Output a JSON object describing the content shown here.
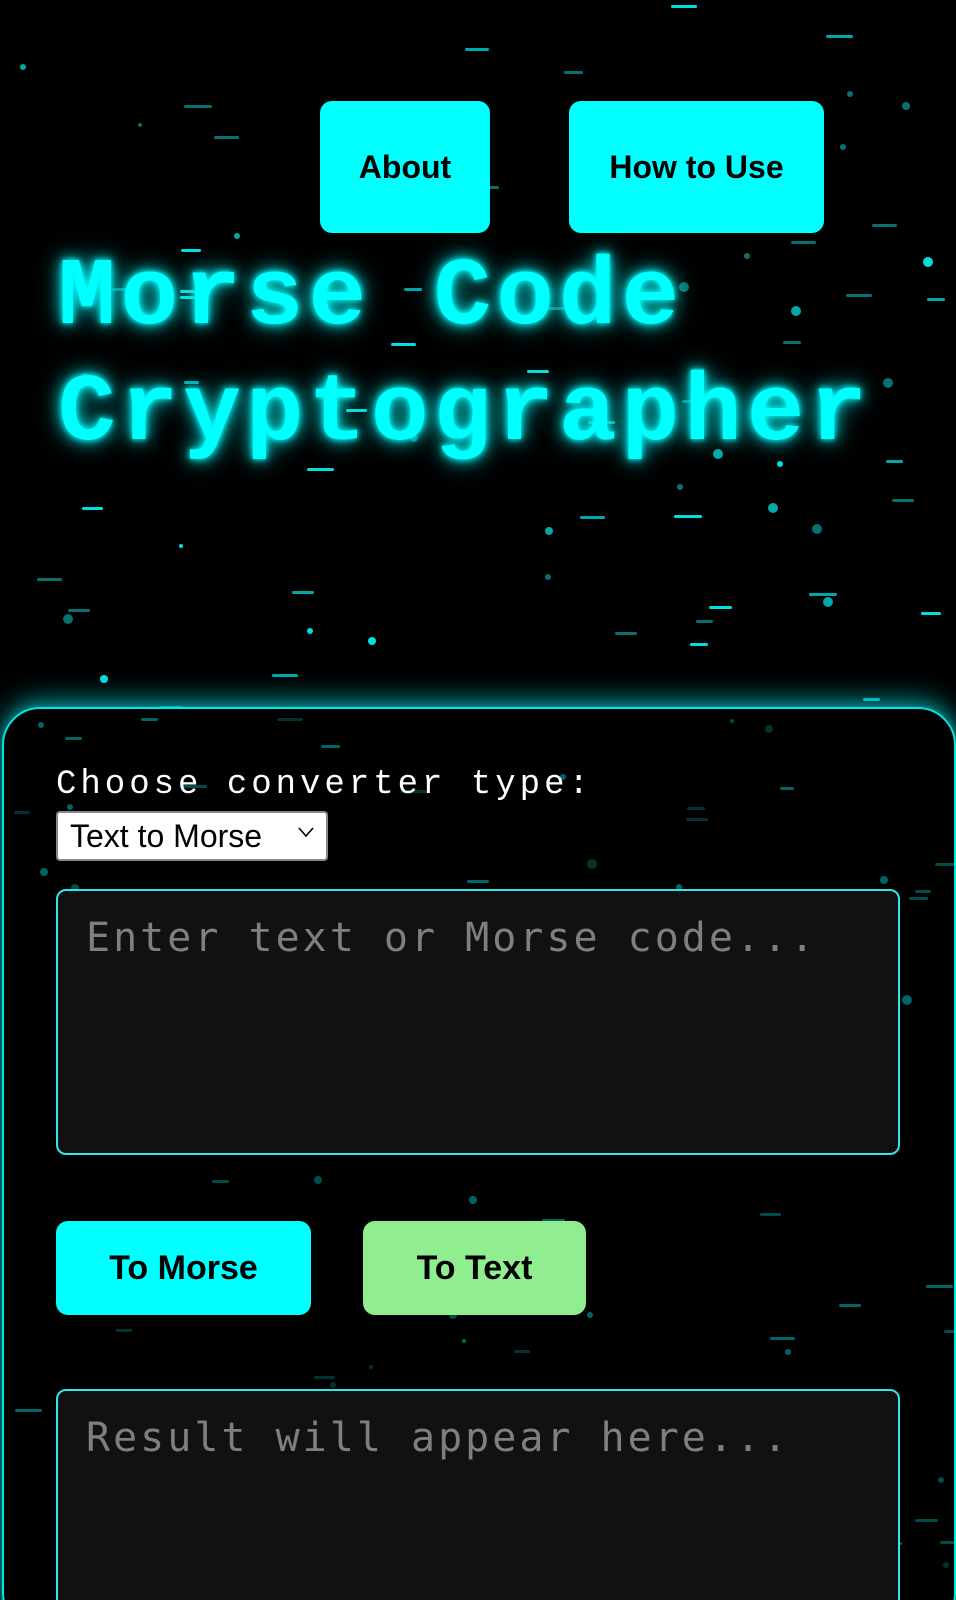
{
  "nav": {
    "about_label": "About",
    "howto_label": "How to Use"
  },
  "header": {
    "title_line1": "Morse Code",
    "title_line2": "Cryptographer"
  },
  "converter": {
    "label": "Choose converter type:",
    "selected_type": "Text to Morse",
    "input_placeholder": "Enter text or Morse code...",
    "to_morse_label": "To Morse",
    "to_text_label": "To Text",
    "result_placeholder": "Result will appear here..."
  },
  "colors": {
    "accent": "#00ffff",
    "secondary_button": "#90ee90",
    "background": "#000000",
    "field_background": "#111111"
  },
  "icons": {
    "select_arrow": "chevron-down-icon"
  }
}
